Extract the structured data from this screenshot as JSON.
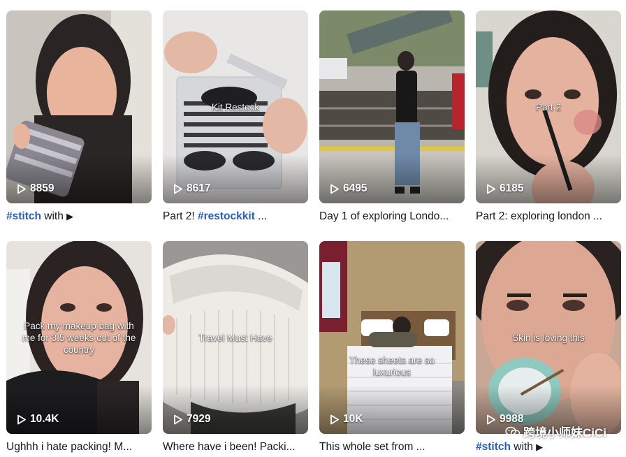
{
  "videos": [
    {
      "views": "8859",
      "overlay": "",
      "caption_tag": "#stitch",
      "caption_text": " with ",
      "caption_icon": "▶",
      "caption_plain": ""
    },
    {
      "views": "8617",
      "overlay": "Kit Restock",
      "caption_plain": "Part 2! ",
      "caption_tag": "#restockkit",
      "caption_text": " ..."
    },
    {
      "views": "6495",
      "overlay": "",
      "caption_plain": "Day 1 of exploring Londo..."
    },
    {
      "views": "6185",
      "overlay": "Part 2",
      "caption_plain": "Part 2: exploring london ..."
    },
    {
      "views": "10.4K",
      "overlay": "Pack my makeup bag with me for 3.5 weeks out of the country",
      "caption_plain": "Ughhh i hate packing! M..."
    },
    {
      "views": "7929",
      "overlay": "Travel Must Have",
      "caption_plain": "Where have i been! Packi..."
    },
    {
      "views": "10K",
      "overlay": "These sheets are so luxurious",
      "caption_plain": "This whole set from ..."
    },
    {
      "views": "9988",
      "overlay": "Skin is loving this",
      "caption_tag": "#stitch",
      "caption_text": " with ",
      "caption_icon": "▶"
    }
  ],
  "watermark": {
    "text": "跨境小师妹CiCi",
    "icon": "wechat-logo-icon"
  },
  "colors": {
    "hashtag": "#2b5db9",
    "caption": "#161823"
  }
}
